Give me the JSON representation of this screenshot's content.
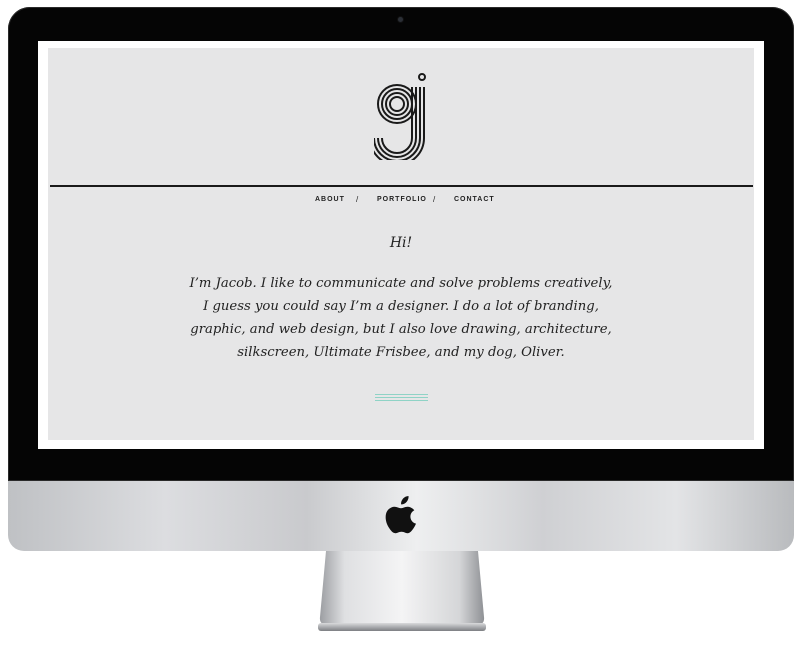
{
  "site": {
    "logo_icon": "gj-monogram-icon",
    "nav": {
      "items": [
        "About",
        "Portfolio",
        "Contact"
      ],
      "separator": "/"
    },
    "greeting": "Hi!",
    "bio_lines": [
      "I’m Jacob. I like to communicate and solve problems creatively,",
      "I guess you could say I’m a designer. I do a lot of branding,",
      "graphic, and web design, but I also love drawing, architecture,",
      "silkscreen, Ultimate Frisbee, and my dog, Oliver."
    ],
    "accent_color": "#8fd3c6",
    "background_color": "#e6e6e7"
  },
  "device": {
    "type": "iMac",
    "brand_icon": "apple-logo-icon",
    "bezel_color": "#050505"
  }
}
